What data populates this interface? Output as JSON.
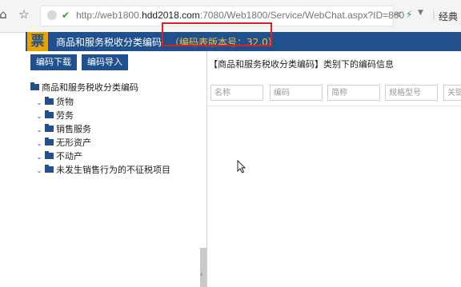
{
  "browser": {
    "url_prefix": "http://web1800.",
    "url_domain": "hdd2018.com",
    "url_rest": ":7080/Web1800/Service/WebChat.aspx?ID=800",
    "ext_label": "经典"
  },
  "header": {
    "logo_char": "票",
    "title": "商品和服务税收分类编码",
    "version": "（编码表版本号：32.0）"
  },
  "left": {
    "download_label": "编码下载",
    "import_label": "编码导入",
    "root_label": "商品和服务税收分类编码",
    "items": [
      "货物",
      "劳务",
      "销售服务",
      "无形资产",
      "不动产",
      "未发生销售行为的不征税项目"
    ]
  },
  "right": {
    "title": "【商品和服务税收分类编码】类别下的编码信息",
    "placeholders": [
      "名称",
      "编码",
      "简称",
      "规格型号",
      "关键"
    ]
  },
  "colors": {
    "header_bg": "#21508f",
    "version_text": "#f3c13a",
    "highlight_box": "#e0201c"
  }
}
